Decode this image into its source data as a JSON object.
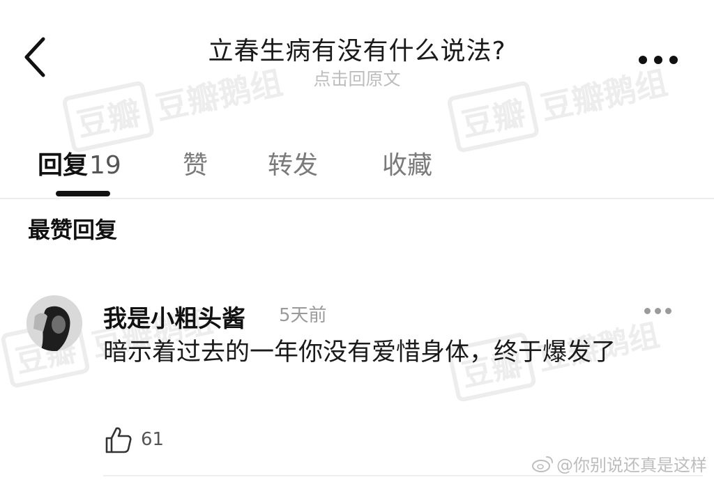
{
  "header": {
    "title": "立春生病有没有什么说法?",
    "subtitle": "点击回原文"
  },
  "watermark": {
    "box": "豆瓣",
    "text": "豆瓣鹅组"
  },
  "tabs": [
    {
      "label": "回复",
      "count": "19",
      "active": true
    },
    {
      "label": "赞"
    },
    {
      "label": "转发"
    },
    {
      "label": "收藏"
    }
  ],
  "section_title": "最赞回复",
  "reply": {
    "username": "我是小粗头酱",
    "timestamp": "5天前",
    "text": "暗示着过去的一年你没有爱惜身体，终于爆发了",
    "likes": "61"
  },
  "credit": "@你别说还真是这样",
  "icons": {
    "back": "chevron-left-icon",
    "more": "more-dots-icon",
    "like": "thumbs-up-icon",
    "credit": "weibo-icon"
  },
  "colors": {
    "text_primary": "#111111",
    "text_muted": "#9a9a9a",
    "subtitle": "#bdbdbd",
    "watermark": "#ededed"
  }
}
